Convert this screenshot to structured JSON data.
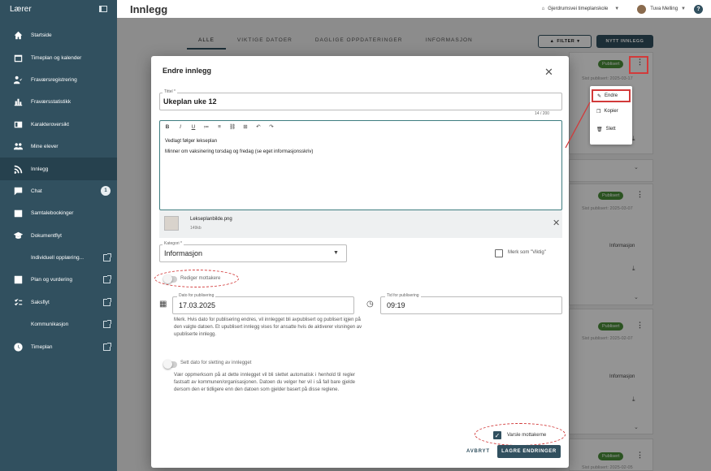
{
  "app": {
    "role": "Lærer",
    "page_title": "Innlegg"
  },
  "topbar": {
    "school": "Gjerdrumsvei timeplanskole",
    "user": "Tuva Melling",
    "help": "?"
  },
  "sidebar": {
    "items": [
      {
        "label": "Startside",
        "icon": "home-icon"
      },
      {
        "label": "Timeplan og kalender",
        "icon": "calendar-icon"
      },
      {
        "label": "Fraværsregistrering",
        "icon": "attendance-icon"
      },
      {
        "label": "Fraværsstatistikk",
        "icon": "bar-chart-icon"
      },
      {
        "label": "Karakteroversikt",
        "icon": "grades-icon"
      },
      {
        "label": "Mine elever",
        "icon": "group-icon"
      },
      {
        "label": "Innlegg",
        "icon": "rss-icon"
      },
      {
        "label": "Chat",
        "icon": "chat-icon",
        "badge": "1"
      },
      {
        "label": "Samtalebookinger",
        "icon": "booking-icon"
      },
      {
        "label": "Dokumentflyt",
        "icon": "school-icon"
      },
      {
        "label": "Individuell opplæring...",
        "icon": "",
        "external": true
      },
      {
        "label": "Plan og vurdering",
        "icon": "plan-icon",
        "external": true
      },
      {
        "label": "Saksflyt",
        "icon": "saksflyt-icon",
        "external": true
      },
      {
        "label": "Kommunikasjon",
        "icon": "",
        "external": true
      },
      {
        "label": "Timeplan",
        "icon": "clock-icon",
        "external": true
      }
    ]
  },
  "background": {
    "tabs": [
      "ALLE",
      "VIKTIGE DATOER",
      "DAGLIGE OPPDATERINGER",
      "INFORMASJON"
    ],
    "filter_label": "FILTER",
    "new_label": "NYTT INNLEGG",
    "status_label": "Publisert",
    "published_1": "Sist publisert: 2025-03-17",
    "published_2": "Sist publisert: 2025-03-07",
    "published_3": "Sist publisert: 2025-02-07",
    "published_4": "Sist publisert: 2025-02-05",
    "info_label": "Informasjon"
  },
  "context_menu": {
    "edit": "Endre",
    "copy": "Kopier",
    "delete": "Slett"
  },
  "modal": {
    "title": "Endre innlegg",
    "title_field": {
      "label": "Tittel *",
      "value": "Ukeplan uke 12",
      "counter": "14 / 200"
    },
    "editor": {
      "toolbar": [
        "B",
        "I",
        "U",
        "≔",
        "≡",
        "⛓",
        "⊞",
        "↶",
        "↷"
      ],
      "lines": [
        "Vedlagt følger lekseplan",
        "Minner om vaksinering torsdag og fredag (se eget informasjonsskriv)"
      ]
    },
    "attachment": {
      "name": "Lekseplanbilde.png",
      "size": "149kb"
    },
    "category": {
      "label": "Kategori *",
      "value": "Informasjon"
    },
    "important_label": "Merk som \"Viktig\"",
    "edit_recipients_label": "Rediger mottakere",
    "publish_date": {
      "label": "Dato for publisering",
      "value": "17.03.2025"
    },
    "publish_time": {
      "label": "Tid for publisering",
      "value": "09:19"
    },
    "publish_note": "Merk. Hvis dato for publisering endres, vil innlegget bli avpublisert og publisert igjen på den valgte datoen. Et upublisert innlegg vises for ansatte hvis de aktiverer visningen av upubliserte innlegg.",
    "delete_date_label": "Sett dato for sletting av innlegget",
    "delete_note": "Vær oppmerksom på at dette innlegget vil bli slettet automatisk i henhold til regler fastsatt av kommunen/organisasjonen. Datoen du velger her vil i så fall bare gjelde dersom den er tidligere enn den datoen som gjelder basert på disse reglene.",
    "notify_label": "Varsle mottakerne",
    "cancel_label": "AVBRYT",
    "save_label": "LAGRE ENDRINGER"
  },
  "colors": {
    "primary": "#31505f",
    "accent": "#3e7d80",
    "annotation": "#d23a3a",
    "status_green": "#4a8f3a"
  }
}
